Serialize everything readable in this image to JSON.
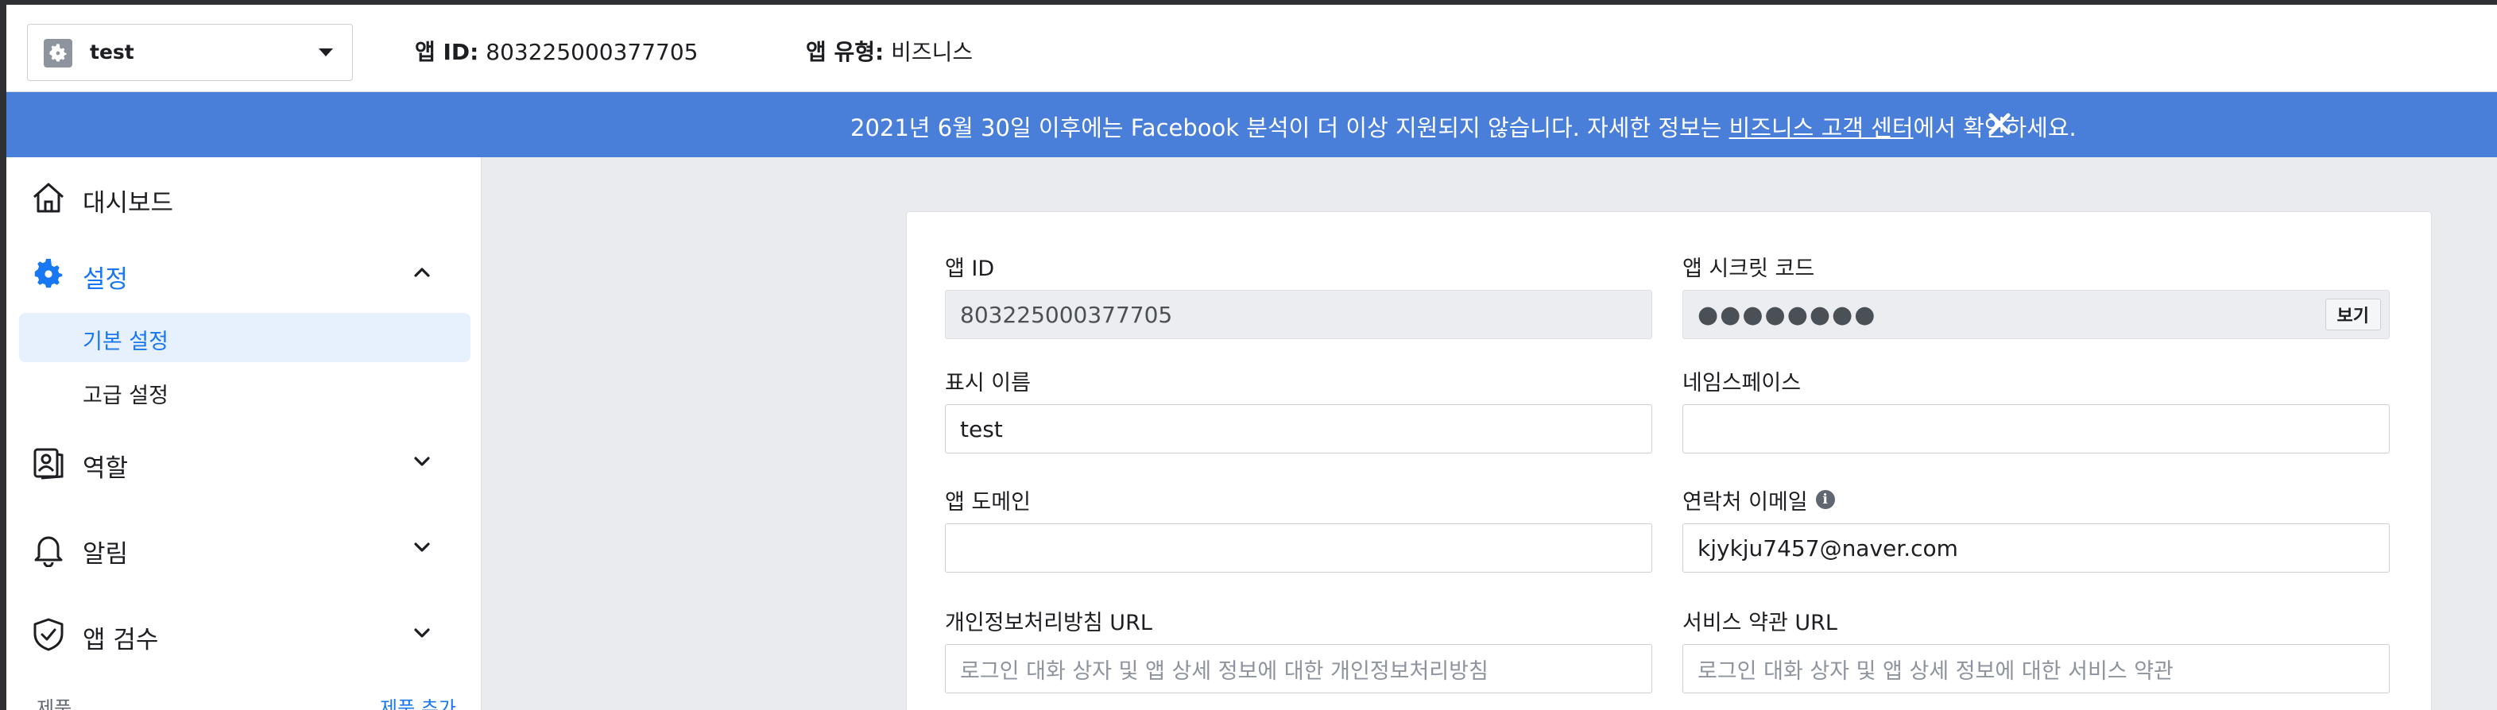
{
  "header": {
    "app_name": "test",
    "app_id_label": "앱 ID:",
    "app_id_value": "803225000377705",
    "app_type_label": "앱 유형:",
    "app_type_value": "비즈니스"
  },
  "banner": {
    "message_before": "2021년 6월 30일 이후에는 Facebook 분석이 더 이상 지원되지 않습니다. 자세한 정보는 ",
    "link_text": "비즈니스 고객 센터",
    "message_after": "에서 확인하세요.",
    "background": "#4a7fd9"
  },
  "sidebar": {
    "items": [
      {
        "label": "대시보드",
        "icon": "home-icon"
      },
      {
        "label": "설정",
        "icon": "gear-icon",
        "expanded": true
      },
      {
        "label": "역할",
        "icon": "roles-icon"
      },
      {
        "label": "알림",
        "icon": "bell-icon"
      },
      {
        "label": "앱 검수",
        "icon": "shield-check-icon"
      }
    ],
    "sub_items": [
      {
        "label": "기본 설정",
        "selected": true
      },
      {
        "label": "고급 설정",
        "selected": false
      }
    ],
    "cut_left": "제품",
    "cut_right": "제품 추가"
  },
  "form": {
    "app_id": {
      "label": "앱 ID",
      "value": "803225000377705"
    },
    "app_secret": {
      "label": "앱 시크릿 코드",
      "value": "●●●●●●●●",
      "show_label": "보기"
    },
    "display_name": {
      "label": "표시 이름",
      "value": "test"
    },
    "namespace": {
      "label": "네임스페이스",
      "value": ""
    },
    "app_domain": {
      "label": "앱 도메인",
      "value": ""
    },
    "contact_email": {
      "label": "연락처 이메일",
      "value": "kjykju7457@naver.com"
    },
    "privacy_url": {
      "label": "개인정보처리방침 URL",
      "placeholder": "로그인 대화 상자 및 앱 상세 정보에 대한 개인정보처리방침"
    },
    "terms_url": {
      "label": "서비스 약관 URL",
      "placeholder": "로그인 대화 상자 및 앱 상세 정보에 대한 서비스 약관"
    }
  },
  "colors": {
    "accent": "#1877f2",
    "selected_bg": "#e7f0fd"
  }
}
